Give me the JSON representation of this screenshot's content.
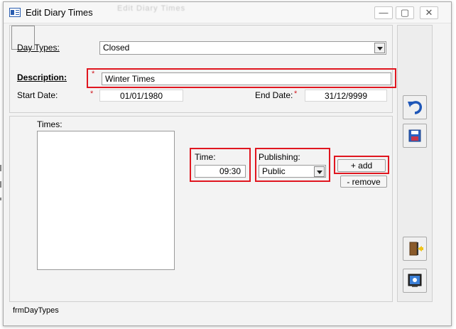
{
  "window": {
    "title": "Edit Diary Times",
    "ghost_title": "Edit Diary Times",
    "controls": {
      "minimize": "—",
      "restore": "▢",
      "close": "✕"
    }
  },
  "form": {
    "day_types": {
      "label": "Day Types:",
      "value": "Closed"
    },
    "description": {
      "label": "Description:",
      "value": "Winter Times",
      "required_mark": "*"
    },
    "start_date": {
      "label": "Start Date:",
      "value": "01/01/1980",
      "required_mark": "*"
    },
    "end_date": {
      "label": "End Date:",
      "value": "31/12/9999",
      "required_mark": "*"
    },
    "times": {
      "label": "Times:",
      "items": []
    },
    "time": {
      "label": "Time:",
      "value": "09:30"
    },
    "publishing": {
      "label": "Publishing:",
      "value": "Public"
    },
    "add_label": "+ add",
    "remove_label": "- remove"
  },
  "status": {
    "form_name": "frmDayTypes"
  },
  "side_buttons": [
    {
      "name": "undo-icon"
    },
    {
      "name": "save-icon"
    },
    {
      "name": "exit-door-icon"
    },
    {
      "name": "screen-icon"
    }
  ],
  "colors": {
    "highlight": "#e0161f",
    "required": "#d01b22",
    "accent_blue": "#2a5db0"
  }
}
